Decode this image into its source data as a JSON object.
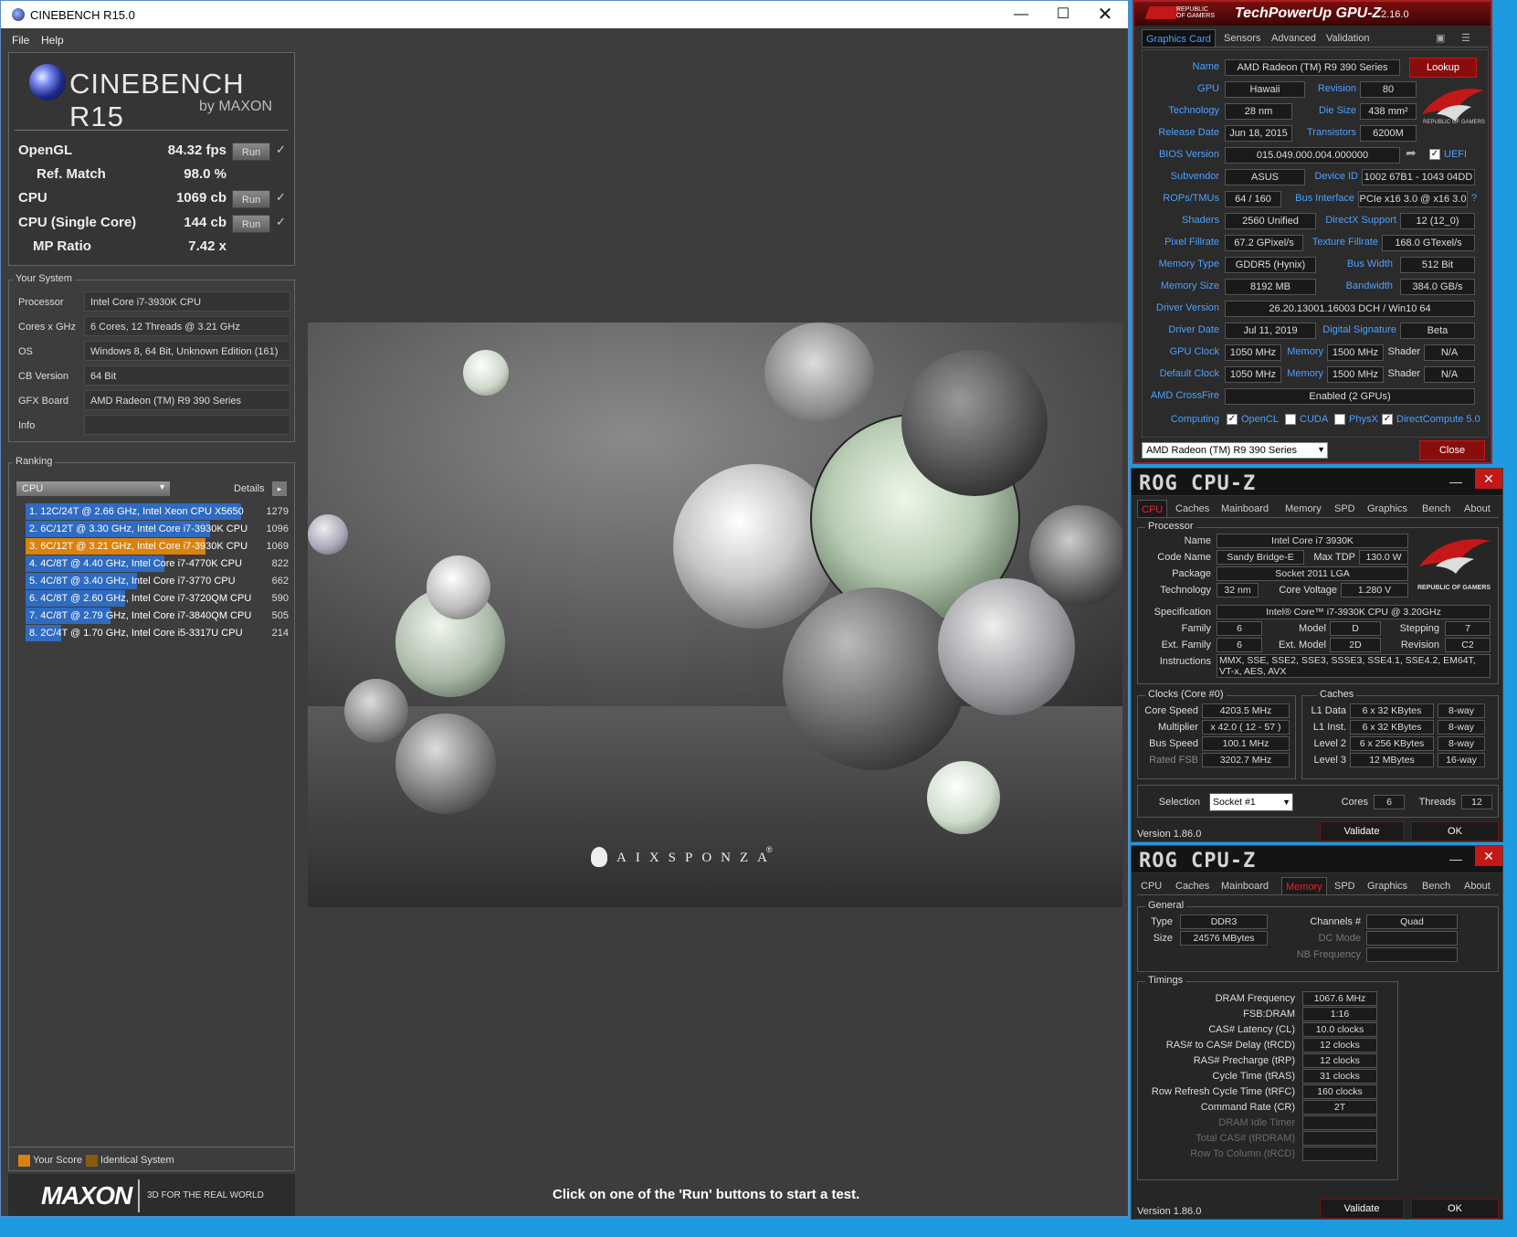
{
  "cinebench": {
    "title": "CINEBENCH R15.0",
    "menu": [
      "File",
      "Help"
    ],
    "logo_text": "CINEBENCH R15",
    "logo_by": "by MAXON",
    "scores": {
      "opengl_label": "OpenGL",
      "opengl_value": "84.32 fps",
      "refmatch_label": "Ref. Match",
      "refmatch_value": "98.0 %",
      "cpu_label": "CPU",
      "cpu_value": "1069 cb",
      "cpusingle_label": "CPU (Single Core)",
      "cpusingle_value": "144 cb",
      "mp_label": "MP Ratio",
      "mp_value": "7.42 x",
      "run_label": "Run",
      "check": "✓"
    },
    "system": {
      "legend": "Your System",
      "rows": [
        {
          "k": "Processor",
          "v": "Intel Core i7-3930K CPU"
        },
        {
          "k": "Cores x GHz",
          "v": "6 Cores, 12 Threads @ 3.21 GHz"
        },
        {
          "k": "OS",
          "v": "Windows 8, 64 Bit, Unknown Edition (161)"
        },
        {
          "k": "CB Version",
          "v": "64 Bit"
        },
        {
          "k": "GFX Board",
          "v": "AMD Radeon (TM) R9 390 Series"
        },
        {
          "k": "Info",
          "v": ""
        }
      ]
    },
    "ranking": {
      "legend": "Ranking",
      "dropdown": "CPU",
      "details": "Details",
      "items": [
        {
          "label": "1. 12C/24T @ 2.66 GHz, Intel Xeon CPU X5650",
          "score": "1279",
          "fill": 1.0,
          "color": "#2f6bc0"
        },
        {
          "label": "2. 6C/12T @ 3.30 GHz,  Intel Core i7-3930K CPU",
          "score": "1096",
          "fill": 0.857,
          "color": "#2f6bc0"
        },
        {
          "label": "3. 6C/12T @ 3.21 GHz,  Intel Core i7-3930K CPU",
          "score": "1069",
          "fill": 0.836,
          "color": "#d9820f"
        },
        {
          "label": "4. 4C/8T @ 4.40 GHz, Intel Core i7-4770K CPU",
          "score": "822",
          "fill": 0.643,
          "color": "#2f6bc0"
        },
        {
          "label": "5. 4C/8T @ 3.40 GHz,  Intel Core i7-3770 CPU",
          "score": "662",
          "fill": 0.518,
          "color": "#2f6bc0"
        },
        {
          "label": "6. 4C/8T @ 2.60 GHz, Intel Core i7-3720QM CPU",
          "score": "590",
          "fill": 0.461,
          "color": "#2f6bc0"
        },
        {
          "label": "7. 4C/8T @ 2.79 GHz, Intel Core i7-3840QM CPU",
          "score": "505",
          "fill": 0.395,
          "color": "#2f6bc0"
        },
        {
          "label": "8. 2C/4T @ 1.70 GHz,  Intel Core i5-3317U CPU",
          "score": "214",
          "fill": 0.167,
          "color": "#2f6bc0"
        }
      ],
      "legend_your": "Your Score",
      "legend_identical": "Identical System"
    },
    "footer_brand": "MAXON",
    "footer_tag": "3D FOR THE REAL WORLD",
    "status": "Click on one of the 'Run' buttons to start a test.",
    "render_watermark": "AIXSPONZA",
    "render_mark": "®"
  },
  "gpuz": {
    "title": "TechPowerUp GPU-Z",
    "version": "2.16.0",
    "rog_small": "REPUBLIC OF GAMERS",
    "tabs": [
      "Graphics Card",
      "Sensors",
      "Advanced",
      "Validation"
    ],
    "lookup": "Lookup",
    "name_label": "Name",
    "name": "AMD Radeon (TM) R9 390 Series",
    "gpu_label": "GPU",
    "gpu": "Hawaii",
    "revision_label": "Revision",
    "revision": "80",
    "tech_label": "Technology",
    "tech": "28 nm",
    "diesize_label": "Die Size",
    "diesize": "438 mm²",
    "release_label": "Release Date",
    "release": "Jun 18, 2015",
    "trans_label": "Transistors",
    "trans": "6200M",
    "bios_label": "BIOS Version",
    "bios": "015.049.000.004.000000",
    "uefi": "UEFI",
    "subvendor_label": "Subvendor",
    "subvendor": "ASUS",
    "deviceid_label": "Device ID",
    "deviceid": "1002 67B1 - 1043 04DD",
    "rops_label": "ROPs/TMUs",
    "rops": "64 / 160",
    "bus_label": "Bus Interface",
    "bus": "PCIe x16 3.0 @ x16 3.0",
    "help": "?",
    "shaders_label": "Shaders",
    "shaders": "2560 Unified",
    "dx_label": "DirectX Support",
    "dx": "12 (12_0)",
    "pixel_label": "Pixel Fillrate",
    "pixel": "67.2 GPixel/s",
    "texture_label": "Texture Fillrate",
    "texture": "168.0 GTexel/s",
    "memtype_label": "Memory Type",
    "memtype": "GDDR5 (Hynix)",
    "buswidth_label": "Bus Width",
    "buswidth": "512 Bit",
    "memsize_label": "Memory Size",
    "memsize": "8192 MB",
    "bandwidth_label": "Bandwidth",
    "bandwidth": "384.0 GB/s",
    "driver_label": "Driver Version",
    "driver": "26.20.13001.16003 DCH / Win10 64",
    "driverdate_label": "Driver Date",
    "driverdate": "Jul 11, 2019",
    "digsig_label": "Digital Signature",
    "digsig": "Beta",
    "gpuclock_label": "GPU Clock",
    "gpuclock": "1050 MHz",
    "memory_label": "Memory",
    "memclock": "1500 MHz",
    "shader_label": "Shader",
    "shader": "N/A",
    "defclock_label": "Default Clock",
    "defclock": "1050 MHz",
    "defmem": "1500 MHz",
    "defshader": "N/A",
    "crossfire_label": "AMD CrossFire",
    "crossfire": "Enabled (2 GPUs)",
    "computing_label": "Computing",
    "compute": [
      "OpenCL",
      "CUDA",
      "PhysX",
      "DirectCompute 5.0"
    ],
    "select": "AMD Radeon (TM) R9 390 Series",
    "close": "Close"
  },
  "cpuz1": {
    "title": "ROG CPU-Z",
    "tabs": [
      "CPU",
      "Caches",
      "Mainboard",
      "Memory",
      "SPD",
      "Graphics",
      "Bench",
      "About"
    ],
    "processor_legend": "Processor",
    "name_label": "Name",
    "name": "Intel Core i7 3930K",
    "codename_label": "Code Name",
    "codename": "Sandy Bridge-E",
    "maxtdp_label": "Max TDP",
    "maxtdp": "130.0 W",
    "package_label": "Package",
    "package": "Socket 2011 LGA",
    "tech_label": "Technology",
    "tech": "32 nm",
    "voltage_label": "Core Voltage",
    "voltage": "1.280 V",
    "spec_label": "Specification",
    "spec": "Intel® Core™ i7-3930K CPU @ 3.20GHz",
    "family_label": "Family",
    "family": "6",
    "model_label": "Model",
    "model": "D",
    "stepping_label": "Stepping",
    "stepping": "7",
    "extfamily_label": "Ext. Family",
    "extfamily": "6",
    "extmodel_label": "Ext. Model",
    "extmodel": "2D",
    "revision_label": "Revision",
    "revision": "C2",
    "instr_label": "Instructions",
    "instr": "MMX, SSE, SSE2, SSE3, SSSE3, SSE4.1, SSE4.2, EM64T, VT-x, AES, AVX",
    "clocks_legend": "Clocks (Core #0)",
    "corespeed_label": "Core Speed",
    "corespeed": "4203.5 MHz",
    "mult_label": "Multiplier",
    "mult": "x 42.0 ( 12 - 57 )",
    "busspeed_label": "Bus Speed",
    "busspeed": "100.1 MHz",
    "ratedfsb_label": "Rated FSB",
    "ratedfsb": "3202.7 MHz",
    "caches_legend": "Caches",
    "l1d_label": "L1 Data",
    "l1d": "6 x 32 KBytes",
    "l1d_way": "8-way",
    "l1i_label": "L1 Inst.",
    "l1i": "6 x 32 KBytes",
    "l1i_way": "8-way",
    "l2_label": "Level 2",
    "l2": "6 x 256 KBytes",
    "l2_way": "8-way",
    "l3_label": "Level 3",
    "l3": "12 MBytes",
    "l3_way": "16-way",
    "selection_label": "Selection",
    "selection": "Socket #1",
    "cores_label": "Cores",
    "cores": "6",
    "threads_label": "Threads",
    "threads": "12",
    "version": "Version 1.86.0",
    "validate": "Validate",
    "ok": "OK",
    "rog_text": "REPUBLIC OF GAMERS"
  },
  "cpuz2": {
    "title": "ROG CPU-Z",
    "general_legend": "General",
    "type_label": "Type",
    "type": "DDR3",
    "channels_label": "Channels #",
    "channels": "Quad",
    "size_label": "Size",
    "size": "24576 MBytes",
    "dcmode_label": "DC Mode",
    "dcmode": "",
    "nbfreq_label": "NB Frequency",
    "nbfreq": "",
    "timings_legend": "Timings",
    "timings": [
      {
        "k": "DRAM Frequency",
        "v": "1067.6 MHz",
        "dim": false
      },
      {
        "k": "FSB:DRAM",
        "v": "1:16",
        "dim": false
      },
      {
        "k": "CAS# Latency (CL)",
        "v": "10.0 clocks",
        "dim": false
      },
      {
        "k": "RAS# to CAS# Delay (tRCD)",
        "v": "12 clocks",
        "dim": false
      },
      {
        "k": "RAS# Precharge (tRP)",
        "v": "12 clocks",
        "dim": false
      },
      {
        "k": "Cycle Time (tRAS)",
        "v": "31 clocks",
        "dim": false
      },
      {
        "k": "Row Refresh Cycle Time (tRFC)",
        "v": "160 clocks",
        "dim": false
      },
      {
        "k": "Command Rate (CR)",
        "v": "2T",
        "dim": false
      },
      {
        "k": "DRAM Idle Timer",
        "v": "",
        "dim": true
      },
      {
        "k": "Total CAS# (tRDRAM)",
        "v": "",
        "dim": true
      },
      {
        "k": "Row To Column (tRCD)",
        "v": "",
        "dim": true
      }
    ],
    "version": "Version 1.86.0",
    "validate": "Validate",
    "ok": "OK"
  },
  "colors": {
    "accent_red": "#c31818",
    "cinebench_blue": "#2f6bc0",
    "your_score": "#d9820f",
    "gpuz_label": "#4aa0ff"
  }
}
